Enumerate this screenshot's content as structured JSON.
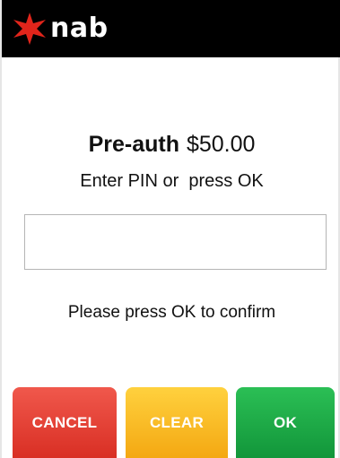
{
  "header": {
    "brand": "nab",
    "logo_icon": "star-icon",
    "logo_color": "#e1251b"
  },
  "transaction": {
    "type": "Pre-auth",
    "amount": "$50.00"
  },
  "prompt": "Enter PIN or  press OK",
  "pin_input": {
    "value": ""
  },
  "confirm_message": "Please press OK to confirm",
  "buttons": {
    "cancel": {
      "label": "CANCEL",
      "color": "#e53e31"
    },
    "clear": {
      "label": "CLEAR",
      "color": "#f9be22"
    },
    "ok": {
      "label": "OK",
      "color": "#1eaa47"
    }
  }
}
